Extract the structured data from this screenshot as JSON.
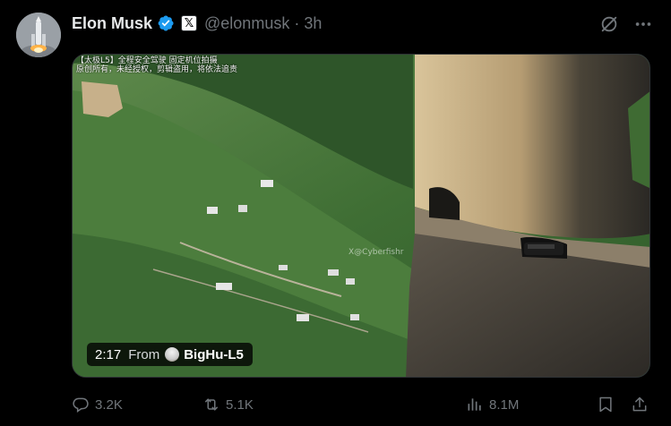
{
  "post": {
    "author": {
      "display_name": "Elon Musk",
      "handle": "@elonmusk",
      "avatar_icon": "rocket-launch-avatar",
      "verified_icon": "verified-badge-icon",
      "affiliation_icon": "x-logo-icon",
      "affiliation_glyph": "𝕏"
    },
    "separator": "·",
    "timestamp": "3h",
    "top_actions": {
      "grok_icon": "grok-icon",
      "more_icon": "more-icon"
    },
    "media": {
      "caption_line1": "【太极L5】全程安全驾驶 固定机位拍摄",
      "caption_line2": "原创所有，未经授权，剪辑盗用，将依法追责",
      "watermark": "X@Cyberfishr",
      "duration": "2:17",
      "from_label": "From",
      "source_name": "BigHu-L5"
    },
    "actions": {
      "replies": "3.2K",
      "reposts": "5.1K",
      "views": "8.1M",
      "reply_icon": "reply-icon",
      "repost_icon": "repost-icon",
      "views_icon": "views-icon",
      "bookmark_icon": "bookmark-icon",
      "share_icon": "share-icon"
    }
  },
  "colors": {
    "background": "#000000",
    "text_primary": "#e7e9ea",
    "text_secondary": "#71767b",
    "verified_blue": "#1d9bf0",
    "border": "#2f3336"
  }
}
